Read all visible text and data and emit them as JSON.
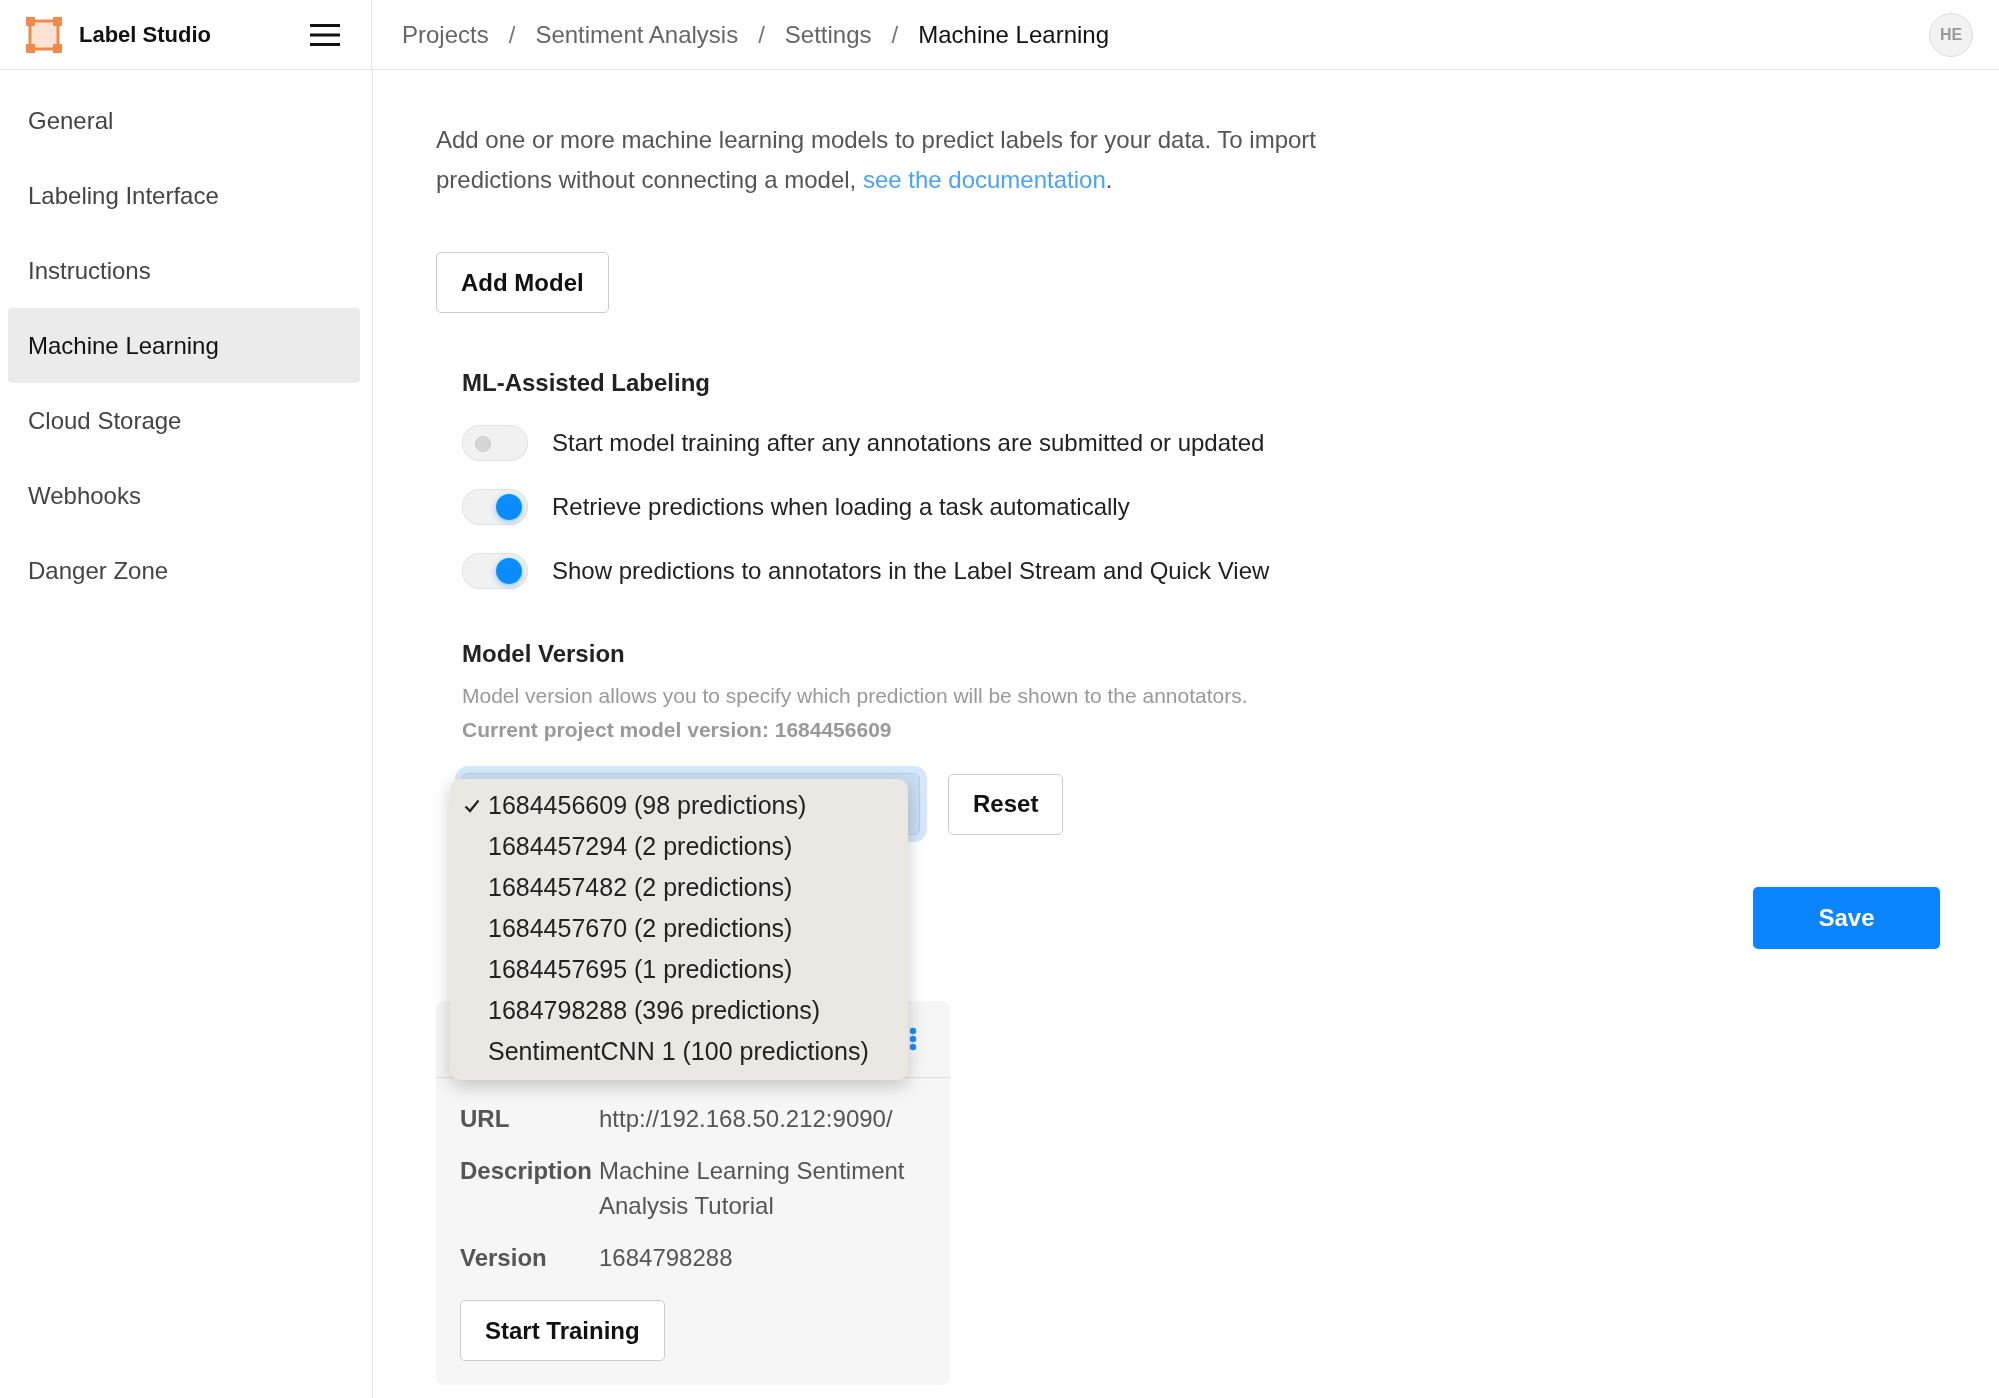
{
  "app": {
    "name": "Label Studio"
  },
  "breadcrumbs": {
    "separator": "/",
    "items": [
      {
        "label": "Projects",
        "current": false
      },
      {
        "label": "Sentiment Analysis",
        "current": false
      },
      {
        "label": "Settings",
        "current": false
      },
      {
        "label": "Machine Learning",
        "current": true
      }
    ]
  },
  "user": {
    "initials": "HE"
  },
  "sidebar": {
    "items": [
      {
        "label": "General",
        "selected": false
      },
      {
        "label": "Labeling Interface",
        "selected": false
      },
      {
        "label": "Instructions",
        "selected": false
      },
      {
        "label": "Machine Learning",
        "selected": true
      },
      {
        "label": "Cloud Storage",
        "selected": false
      },
      {
        "label": "Webhooks",
        "selected": false
      },
      {
        "label": "Danger Zone",
        "selected": false
      }
    ]
  },
  "intro": {
    "text": "Add one or more machine learning models to predict labels for your data. To import predictions without connecting a model, ",
    "link": "see the documentation",
    "after": "."
  },
  "add_model_button": "Add Model",
  "ml_assisted": {
    "title": "ML-Assisted Labeling",
    "toggles": [
      {
        "label": "Start model training after any annotations are submitted or updated",
        "on": false
      },
      {
        "label": "Retrieve predictions when loading a task automatically",
        "on": true
      },
      {
        "label": "Show predictions to annotators in the Label Stream and Quick View",
        "on": true
      }
    ]
  },
  "model_version": {
    "title": "Model Version",
    "help": "Model version allows you to specify which prediction will be shown to the annotators.",
    "current": "Current project model version: 1684456609",
    "select": {
      "expanded": true,
      "options": [
        {
          "label": "1684456609 (98 predictions)",
          "selected": true
        },
        {
          "label": "1684457294 (2 predictions)",
          "selected": false
        },
        {
          "label": "1684457482 (2 predictions)",
          "selected": false
        },
        {
          "label": "1684457670 (2 predictions)",
          "selected": false
        },
        {
          "label": "1684457695 (1 predictions)",
          "selected": false
        },
        {
          "label": "1684798288 (396 predictions)",
          "selected": false
        },
        {
          "label": "SentimentCNN 1 (100 predictions)",
          "selected": false
        }
      ]
    },
    "reset_button": "Reset"
  },
  "save_button": "Save",
  "model_card": {
    "rows": [
      {
        "label": "URL",
        "value": "http://192.168.50.212:9090/"
      },
      {
        "label": "Description",
        "value": "Machine Learning Sentiment Analysis Tutorial"
      },
      {
        "label": "Version",
        "value": "1684798288"
      }
    ],
    "start_training_button": "Start Training"
  }
}
